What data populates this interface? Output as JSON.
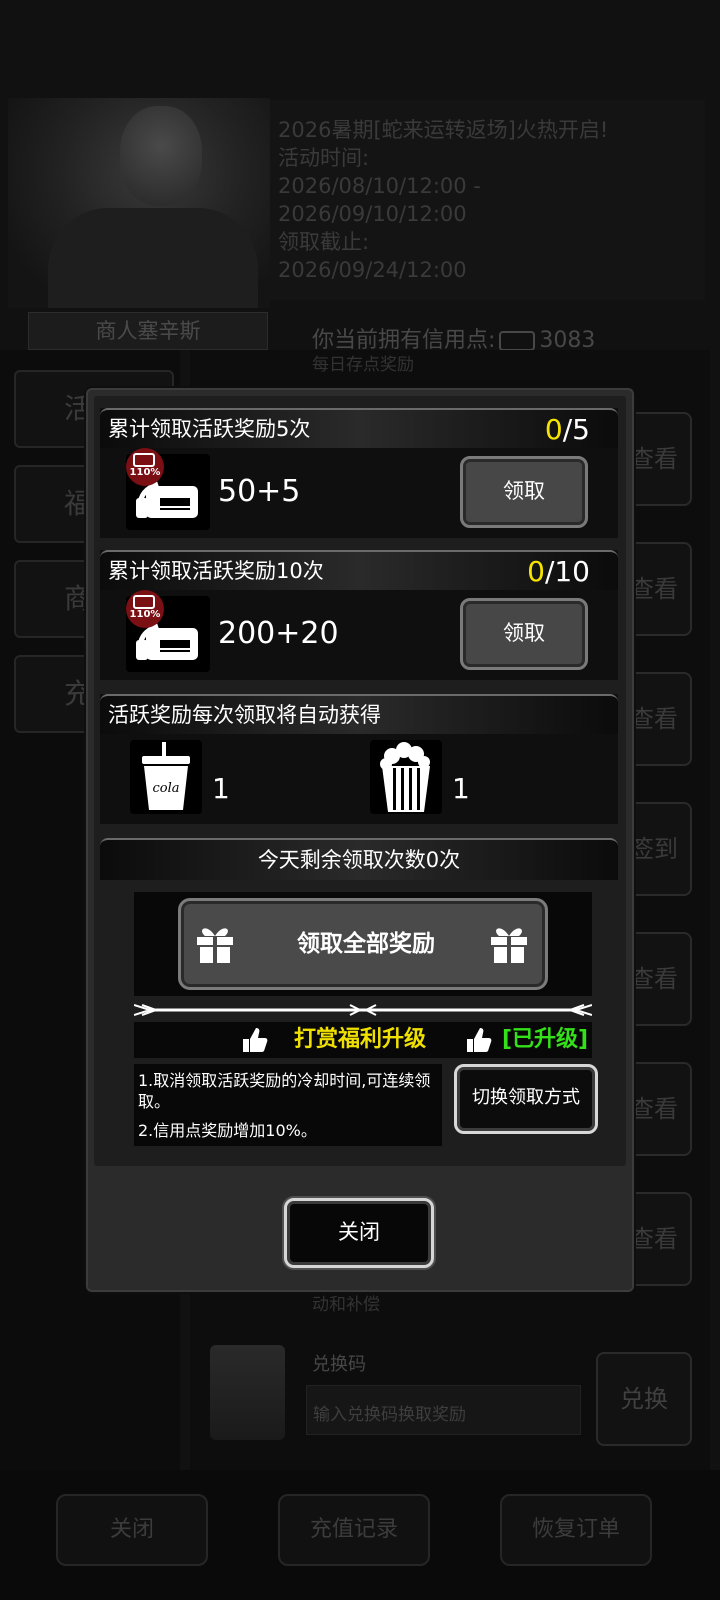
{
  "background": {
    "merchant_name": "商人塞辛斯",
    "announcement": [
      "2026暑期[蛇来运转返场]火热开启!",
      "活动时间:",
      "2026/08/10/12:00 -",
      "2026/09/10/12:00",
      "领取截止:",
      "2026/09/24/12:00"
    ],
    "credit_label": "你当前拥有信用点:",
    "credit_value": "3083",
    "left_tabs": [
      "活",
      "福",
      "商",
      "充"
    ],
    "row_buttons": [
      "查看",
      "查看",
      "查看",
      "签到",
      "查看",
      "查看",
      "查看"
    ],
    "stub_texts": [
      "每日存点奖励",
      "动和补偿"
    ],
    "code": {
      "title": "兑换码",
      "placeholder": "输入兑换码换取奖励",
      "button": "兑换"
    },
    "bottom_buttons": {
      "close": "关闭",
      "recharge_history": "充值记录",
      "restore_order": "恢复订单"
    }
  },
  "modal": {
    "milestones": [
      {
        "title": "累计领取活跃奖励5次",
        "current": "0",
        "target": "/5",
        "badge": "110%",
        "amount": "50+5",
        "button": "领取"
      },
      {
        "title": "累计领取活跃奖励10次",
        "current": "0",
        "target": "/10",
        "badge": "110%",
        "amount": "200+20",
        "button": "领取"
      }
    ],
    "auto_gain": {
      "title": "活跃奖励每次领取将自动获得",
      "items": [
        {
          "icon": "cola-icon",
          "label": "cola",
          "qty": "1"
        },
        {
          "icon": "popcorn-icon",
          "qty": "1"
        }
      ]
    },
    "remaining": "今天剩余领取次数0次",
    "claim_all": "领取全部奖励",
    "upgrade_title": "打赏福利升级",
    "upgraded": "[已升级]",
    "desc": [
      "1.取消领取活跃奖励的冷却时间,可连续领取。",
      "2.信用点奖励增加10%。"
    ],
    "switch_button": "切换领取方式",
    "close_button": "关闭"
  },
  "colors": {
    "count_current": "#f6e400",
    "upgrade_title": "#f0e000",
    "upgraded": "#34e01a",
    "badge": "#7a0f14"
  }
}
